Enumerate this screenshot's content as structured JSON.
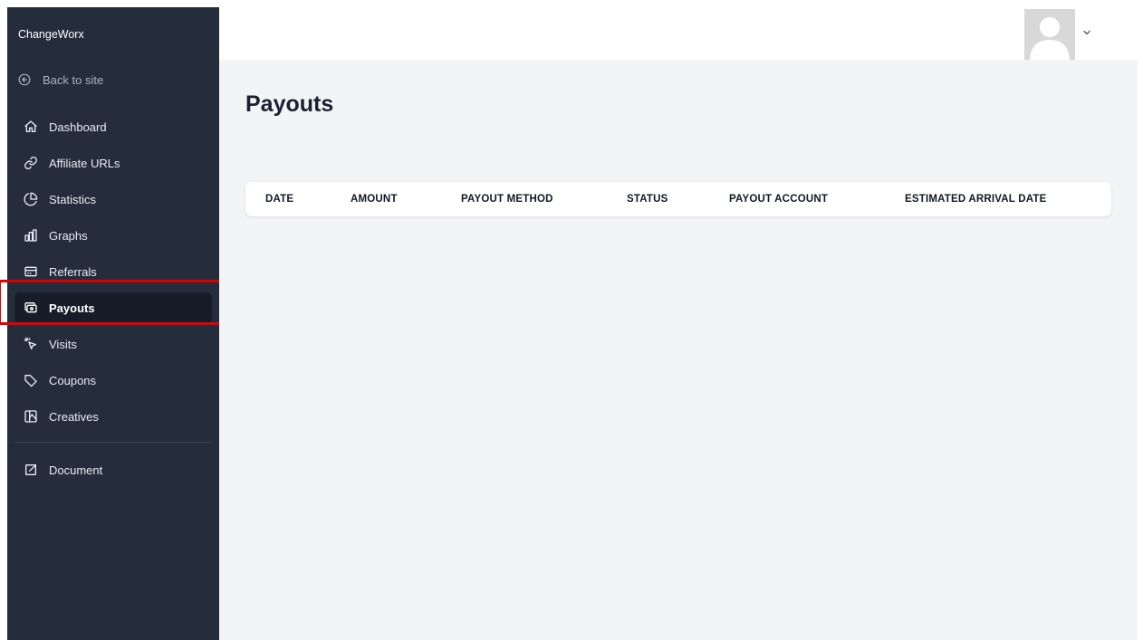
{
  "sidebar": {
    "brand": "ChangeWorx",
    "back_label": "Back to site",
    "items": [
      {
        "label": "Dashboard",
        "icon": "home-icon"
      },
      {
        "label": "Affiliate URLs",
        "icon": "link-icon"
      },
      {
        "label": "Statistics",
        "icon": "pie-chart-icon"
      },
      {
        "label": "Graphs",
        "icon": "bar-chart-icon"
      },
      {
        "label": "Referrals",
        "icon": "card-icon"
      },
      {
        "label": "Payouts",
        "icon": "cash-icon",
        "active": true
      },
      {
        "label": "Visits",
        "icon": "cursor-click-icon"
      },
      {
        "label": "Coupons",
        "icon": "tag-icon"
      },
      {
        "label": "Creatives",
        "icon": "image-icon"
      }
    ],
    "document_label": "Document",
    "accent_highlight": "#e00000"
  },
  "main": {
    "title": "Payouts",
    "table": {
      "columns": [
        "DATE",
        "AMOUNT",
        "PAYOUT METHOD",
        "STATUS",
        "PAYOUT ACCOUNT",
        "ESTIMATED ARRIVAL DATE"
      ],
      "rows": []
    }
  },
  "colors": {
    "sidebar_bg": "#252d3d",
    "active_item_bg": "#161d29",
    "main_bg": "#f3f4f6"
  }
}
